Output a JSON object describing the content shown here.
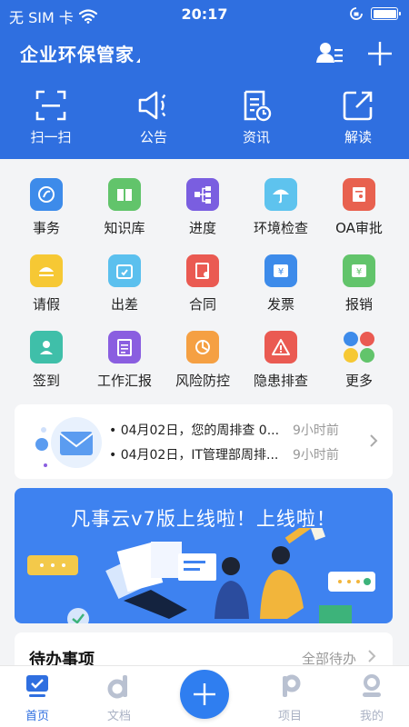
{
  "status_bar": {
    "carrier": "无 SIM 卡",
    "time": "20:17"
  },
  "header": {
    "title": "企业环保管家",
    "contacts_icon": "contacts-icon",
    "add_icon": "plus-icon"
  },
  "quick_actions": [
    {
      "label": "扫一扫",
      "icon": "scan-icon"
    },
    {
      "label": "公告",
      "icon": "megaphone-icon"
    },
    {
      "label": "资讯",
      "icon": "news-icon"
    },
    {
      "label": "解读",
      "icon": "share-out-icon"
    }
  ],
  "grid": [
    {
      "label": "事务",
      "icon": "affairs-icon",
      "color": "#3d8bea"
    },
    {
      "label": "知识库",
      "icon": "book-icon",
      "color": "#62c46b"
    },
    {
      "label": "进度",
      "icon": "flow-icon",
      "color": "#7a5ee0"
    },
    {
      "label": "环境检查",
      "icon": "umbrella-icon",
      "color": "#5ec3ee"
    },
    {
      "label": "OA审批",
      "icon": "approval-icon",
      "color": "#e8614f"
    },
    {
      "label": "请假",
      "icon": "leave-icon",
      "color": "#f6c834"
    },
    {
      "label": "出差",
      "icon": "trip-icon",
      "color": "#5bc0ee"
    },
    {
      "label": "合同",
      "icon": "contract-icon",
      "color": "#ea5a52"
    },
    {
      "label": "发票",
      "icon": "invoice-icon",
      "color": "#3d8bea"
    },
    {
      "label": "报销",
      "icon": "reimburse-icon",
      "color": "#62c46b"
    },
    {
      "label": "签到",
      "icon": "checkin-icon",
      "color": "#3fbfa9"
    },
    {
      "label": "工作汇报",
      "icon": "report-icon",
      "color": "#8a5ee0"
    },
    {
      "label": "风险防控",
      "icon": "risk-icon",
      "color": "#f5a043"
    },
    {
      "label": "隐患排查",
      "icon": "hazard-icon",
      "color": "#ea5a52"
    },
    {
      "label": "更多",
      "icon": "more-icon",
      "color": "#62c46b"
    }
  ],
  "notice": {
    "items": [
      {
        "text": "• 04月02日，您的周排查 0...",
        "time": "9小时前"
      },
      {
        "text": "• 04月02日，IT管理部周排...",
        "time": "9小时前"
      }
    ]
  },
  "banner": {
    "title": "凡事云v7版上线啦！上线啦！"
  },
  "todo": {
    "title": "待办事项",
    "all_label": "全部待办"
  },
  "tabbar": [
    {
      "label": "首页",
      "icon": "home-icon",
      "active": true
    },
    {
      "label": "文档",
      "icon": "doc-icon",
      "active": false
    },
    {
      "label": "项目",
      "icon": "project-icon",
      "active": false
    },
    {
      "label": "我的",
      "icon": "profile-icon",
      "active": false
    }
  ]
}
